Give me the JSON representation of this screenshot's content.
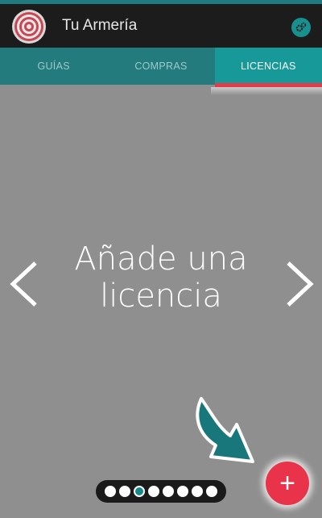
{
  "app": {
    "title": "Tu Armería"
  },
  "tabs": [
    {
      "label": "GUÍAS",
      "active": false
    },
    {
      "label": "COMPRAS",
      "active": false
    },
    {
      "label": "LICENCIAS",
      "active": true
    }
  ],
  "main": {
    "line1": "Añade una",
    "line2": "licencia"
  },
  "pager": {
    "total": 8,
    "active_index": 2
  },
  "fab": {
    "symbol": "+"
  },
  "icons": {
    "logo": "target-icon",
    "settings": "gear-icon",
    "prev": "chevron-left-icon",
    "next": "chevron-right-icon",
    "hint": "curved-arrow-icon"
  },
  "colors": {
    "accent": "#17999a",
    "fab": "#e8334a",
    "tab_indicator": "#e23b4c"
  }
}
